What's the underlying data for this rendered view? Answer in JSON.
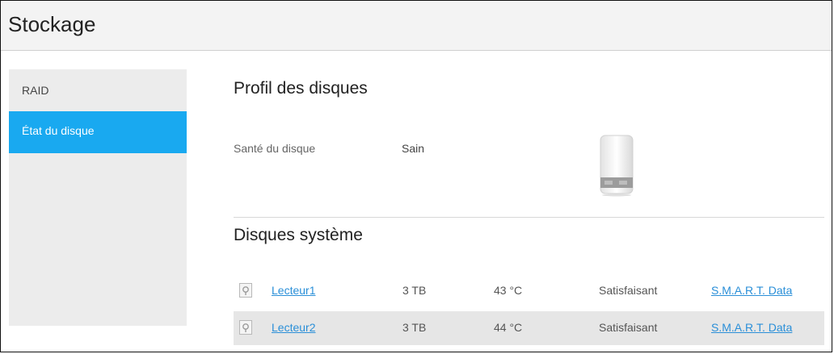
{
  "header": {
    "title": "Stockage"
  },
  "sidebar": {
    "items": [
      {
        "label": "RAID"
      },
      {
        "label": "État du disque"
      }
    ]
  },
  "profile": {
    "title": "Profil des disques",
    "health_label": "Santé du disque",
    "health_value": "Sain",
    "device_icon": "nas-drive-icon"
  },
  "system": {
    "title": "Disques système",
    "rows": [
      {
        "name": "Lecteur1",
        "size": "3 TB",
        "temp": "43 °C",
        "status": "Satisfaisant",
        "smart": "S.M.A.R.T. Data"
      },
      {
        "name": "Lecteur2",
        "size": "3 TB",
        "temp": "44 °C",
        "status": "Satisfaisant",
        "smart": "S.M.A.R.T. Data"
      }
    ]
  },
  "colors": {
    "accent": "#19a9f0",
    "link": "#2a8fd8",
    "sidebar_bg": "#ececec",
    "row_alt": "#e6e6e6"
  }
}
